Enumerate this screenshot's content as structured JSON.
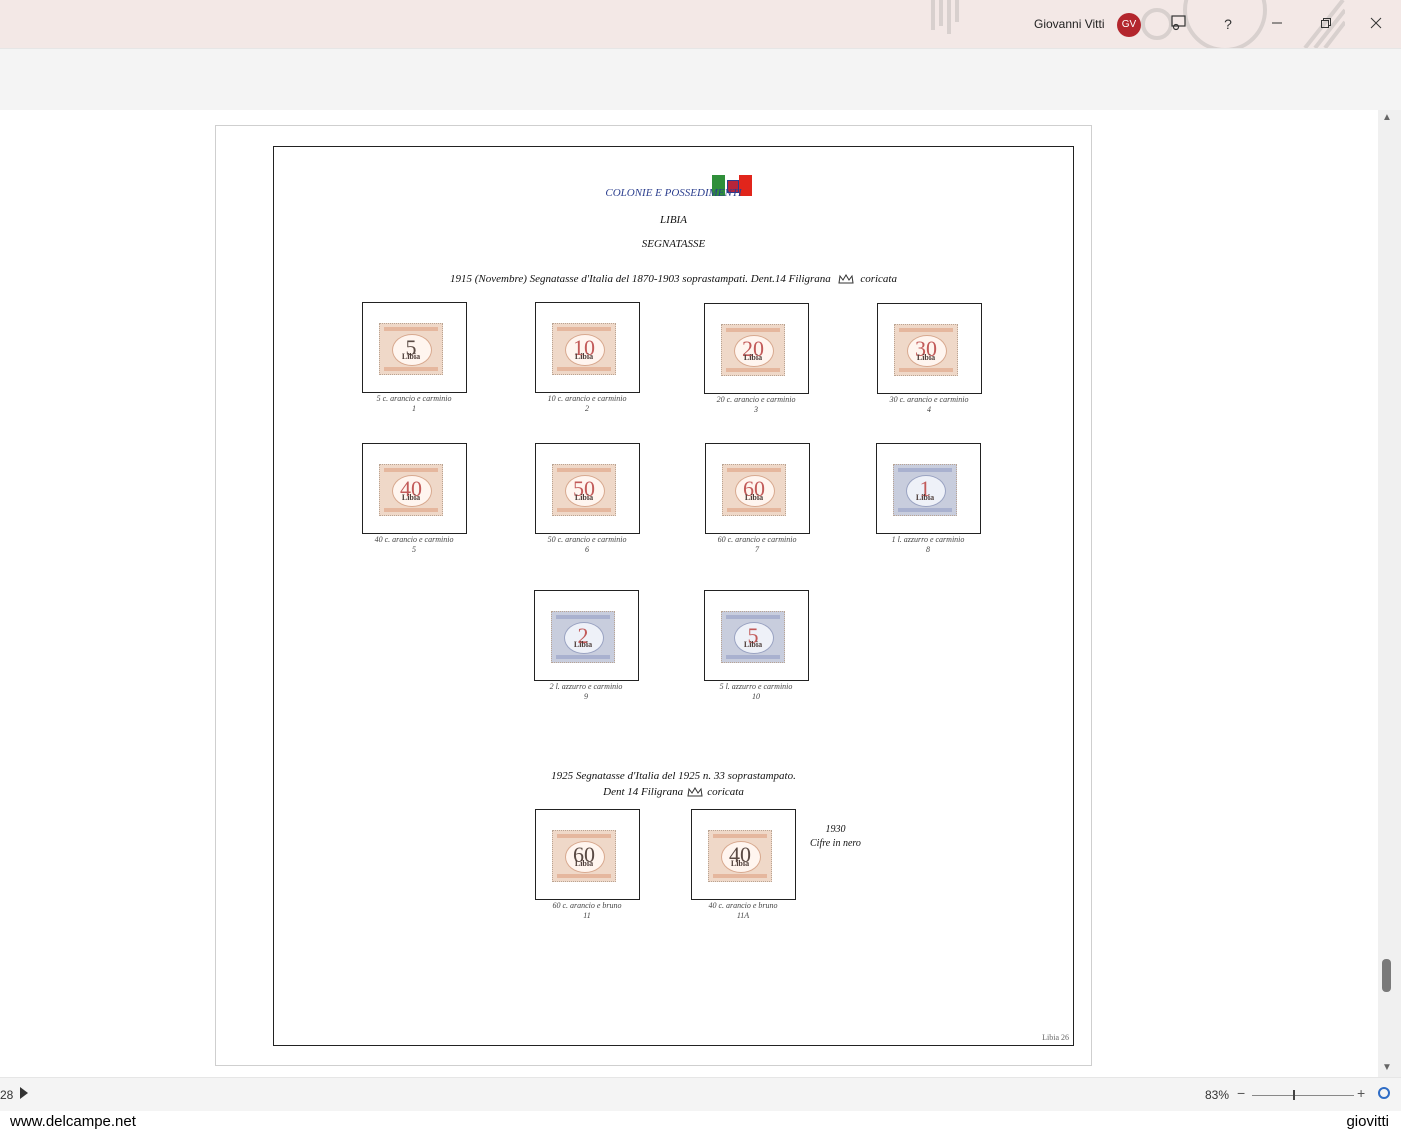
{
  "titlebar": {
    "user_name": "Giovanni Vitti",
    "avatar_initials": "GV",
    "help_label": "?",
    "accent_color": "#b3262d"
  },
  "document": {
    "title_colonies": "COLONIE E POSSEDIMENTI",
    "title_country": "LIBIA",
    "title_section": "SEGNATASSE",
    "heading_1915_a": "1915 (Novembre) Segnatasse d'Italia del 1870-1903 soprastampati. Dent.14 Filigrana",
    "heading_1915_b": "coricata",
    "heading_1925_line1": "1925 Segnatasse d'Italia del 1925 n. 33 soprastampato.",
    "heading_1925_line2a": "Dent 14 Filigrana",
    "heading_1925_line2b": "coricata",
    "note_year": "1930",
    "note_text": "Cifre in nero",
    "page_label": "Libia 26",
    "stamps": [
      {
        "value": "5",
        "overprint": "Libia",
        "caption": "5 c. arancio e carminio",
        "number": "1",
        "color": "orange"
      },
      {
        "value": "10",
        "overprint": "Libia",
        "caption": "10 c. arancio e carminio",
        "number": "2",
        "color": "orange"
      },
      {
        "value": "20",
        "overprint": "Libia",
        "caption": "20 c. arancio e carminio",
        "number": "3",
        "color": "orange"
      },
      {
        "value": "30",
        "overprint": "Libia",
        "caption": "30 c. arancio e carminio",
        "number": "4",
        "color": "orange"
      },
      {
        "value": "40",
        "overprint": "Libia",
        "caption": "40 c. arancio e carminio",
        "number": "5",
        "color": "orange"
      },
      {
        "value": "50",
        "overprint": "Libia",
        "caption": "50 c. arancio e carminio",
        "number": "6",
        "color": "orange"
      },
      {
        "value": "60",
        "overprint": "Libia",
        "caption": "60 c. arancio e carminio",
        "number": "7",
        "color": "orange"
      },
      {
        "value": "1",
        "overprint": "Libia",
        "caption": "1 l. azzurro e carminio",
        "number": "8",
        "color": "blue"
      },
      {
        "value": "2",
        "overprint": "Libia",
        "caption": "2 l. azzurro e carminio",
        "number": "9",
        "color": "blue"
      },
      {
        "value": "5",
        "overprint": "Libia",
        "caption": "5 l. azzurro e carminio",
        "number": "10",
        "color": "blue"
      },
      {
        "value": "60",
        "overprint": "Libia",
        "caption": "60 c. arancio e bruno",
        "number": "11",
        "color": "orange"
      },
      {
        "value": "40",
        "overprint": "Libia",
        "caption": "40 c. arancio e bruno",
        "number": "11A",
        "color": "orange"
      }
    ]
  },
  "statusbar": {
    "page_number": "28",
    "zoom_level": "83%",
    "zoom_minus": "−",
    "zoom_plus": "+"
  },
  "watermark": {
    "left": "www.delcampe.net",
    "right": "giovitti"
  }
}
